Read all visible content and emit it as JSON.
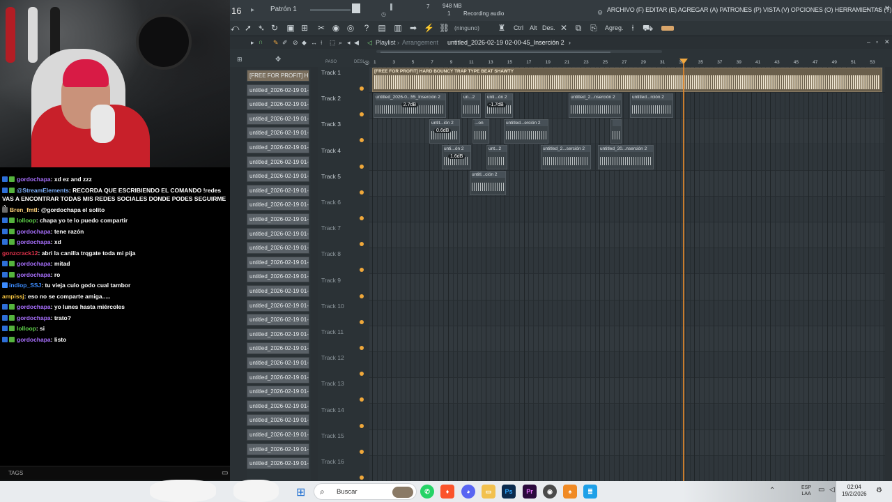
{
  "fl": {
    "pattern_number": "16",
    "pattern_label": "Patrón 1",
    "cpu": "7",
    "memory": "948 MB",
    "voices": "1",
    "recording_text": "Recording audio",
    "menu": "ARCHIVO (F) EDITAR (E) AGREGAR (A) PATRONES (P) VISTA (V) OPCIONES (O) HERRAMIENTAS (T) AYUDA",
    "ninguno": "(ninguno)",
    "ctrl": "Ctrl",
    "alt": "Alt",
    "des": "Des.",
    "agreg": "Agreg.",
    "playlist_label": "Playlist",
    "arrangement_label": "Arrangement",
    "insert_label": "untitled_2026-02-19 02-00-45_Inserción 2",
    "paso": "PASO",
    "desl": "DESL"
  },
  "ruler": [
    "1",
    "3",
    "5",
    "7",
    "9",
    "11",
    "13",
    "15",
    "17",
    "19",
    "21",
    "23",
    "25",
    "27",
    "29",
    "31",
    "33",
    "35",
    "37",
    "39",
    "41",
    "43",
    "45",
    "47",
    "49",
    "51",
    "53"
  ],
  "patterns": [
    "[FREE FOR PROFIT] H...",
    "untitled_2026-02-19 01-...",
    "untitled_2026-02-19 01-...",
    "untitled_2026-02-19 01-...",
    "untitled_2026-02-19 01-...",
    "untitled_2026-02-19 01-...",
    "untitled_2026-02-19 01-...",
    "untitled_2026-02-19 01-...",
    "untitled_2026-02-19 01-...",
    "untitled_2026-02-19 01-...",
    "untitled_2026-02-19 01-...",
    "untitled_2026-02-19 01-...",
    "untitled_2026-02-19 01-...",
    "untitled_2026-02-19 01-...",
    "untitled_2026-02-19 01-...",
    "untitled_2026-02-19 01-...",
    "untitled_2026-02-19 01-...",
    "untitled_2026-02-19 01-...",
    "untitled_2026-02-19 01-...",
    "untitled_2026-02-19 01-...",
    "untitled_2026-02-19 01-...",
    "untitled_2026-02-19 01-...",
    "untitled_2026-02-19 01-...",
    "untitled_2026-02-19 01-...",
    "untitled_2026-02-19 01-...",
    "untitled_2026-02-19 01-...",
    "untitled_2026-02-19 01-...",
    "untitled_2026-02-19 01-..."
  ],
  "tracks": [
    "Track 1",
    "Track 2",
    "Track 3",
    "Track 4",
    "Track 5",
    "Track 6",
    "Track 7",
    "Track 8",
    "Track 9",
    "Track 10",
    "Track 11",
    "Track 12",
    "Track 13",
    "Track 14",
    "Track 15",
    "Track 16"
  ],
  "clips": {
    "beat": "[FREE FOR PROFIT] HARD BOUNCY TRAP TYPE BEAT SHAWTY",
    "t2a": "untitled_2026-0...55_Inserción 2",
    "t2b": "un...2",
    "t2c": "unti...ón 2",
    "t2d": "untitled_2...nserción 2",
    "t2e": "untitled...rción 2",
    "t3a": "untit...ión 2",
    "t3b": "...on",
    "t3c": "untitled...erción 2",
    "t3d": "",
    "t4a": "unti...ón 2",
    "t4b": "unt...2",
    "t4c": "untitled_2...serción 2",
    "t4d": "untitled_20...nserción 2",
    "t5a": "untitl...ción 2",
    "db1": "2.7dB",
    "db2": "-1.7dB",
    "db3": "0.6dB",
    "db4": "1.6dB"
  },
  "chat": [
    {
      "user": "gordochapa",
      "color": "#a970ff",
      "msg": ": xd ez and zzz"
    },
    {
      "user": "@StreamElements",
      "color": "#7fb3ff",
      "msg": ": RECORDA QUE ESCRIBIENDO EL COMANDO !redes VAS A ENCONTRAR TODAS MIS REDES SOCIALES DONDE PODES SEGUIRME :)"
    },
    {
      "user": "Bren_fmtl",
      "color": "#ffd27a",
      "msg": ": @gordochapa el solito"
    },
    {
      "user": "lolloop",
      "color": "#5fd34a",
      "msg": ": chapa yo te lo puedo compartir"
    },
    {
      "user": "gordochapa",
      "color": "#a970ff",
      "msg": ": tene razón"
    },
    {
      "user": "gordochapa",
      "color": "#a970ff",
      "msg": ": xd"
    },
    {
      "user": "gonzcrack12",
      "color": "#e0324b",
      "msg": ": abri la canilla trqgate toda mi pija"
    },
    {
      "user": "gordochapa",
      "color": "#a970ff",
      "msg": ": mitad"
    },
    {
      "user": "gordochapa",
      "color": "#a970ff",
      "msg": ": ro"
    },
    {
      "user": "indiop_SSJ",
      "color": "#3c8cff",
      "msg": ": tu vieja culo godo cual tambor"
    },
    {
      "user": "ampissj",
      "color": "#f0c040",
      "msg": ": eso no se comparte amiga....."
    },
    {
      "user": "gordochapa",
      "color": "#a970ff",
      "msg": ": yo lunes hasta miércoles"
    },
    {
      "user": "gordochapa",
      "color": "#a970ff",
      "msg": ": trato?"
    },
    {
      "user": "lolloop",
      "color": "#5fd34a",
      "msg": ": si"
    },
    {
      "user": "gordochapa",
      "color": "#a970ff",
      "msg": ": listo"
    }
  ],
  "chat_tags": "TAGS",
  "taskbar": {
    "search": "Buscar",
    "lang1": "ESP",
    "lang2": "LAA",
    "time": "02:04",
    "date": "19/2/2026"
  }
}
